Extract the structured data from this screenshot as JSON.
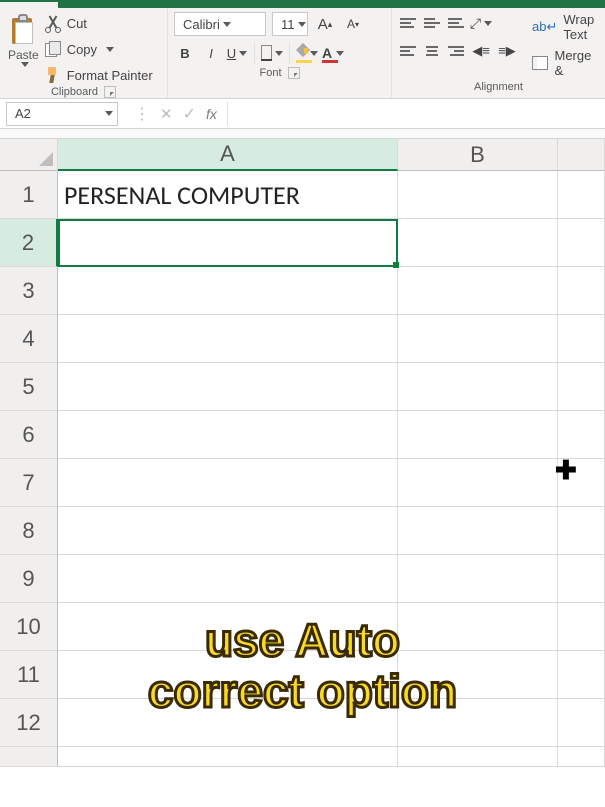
{
  "ribbon": {
    "clipboard": {
      "paste_label": "Paste",
      "cut_label": "Cut",
      "copy_label": "Copy",
      "format_painter_label": "Format Painter",
      "group_label": "Clipboard"
    },
    "font": {
      "name": "Calibri",
      "size": "11",
      "increase": "A",
      "decrease": "A",
      "bold": "B",
      "italic": "I",
      "underline": "U",
      "font_color_glyph": "A",
      "group_label": "Font"
    },
    "alignment": {
      "wrap_label": "Wrap Text",
      "merge_label": "Merge & ",
      "group_label": "Alignment"
    }
  },
  "formula_bar": {
    "name_box": "A2",
    "fx_label": "fx",
    "value": ""
  },
  "columns": [
    "A",
    "B"
  ],
  "rows": [
    "1",
    "2",
    "3",
    "4",
    "5",
    "6",
    "7",
    "8",
    "9",
    "10",
    "11",
    "12"
  ],
  "active_cell": "A2",
  "cells": {
    "A1": "PERSENAL COMPUTER"
  },
  "caption_line1": "use Auto",
  "caption_line2": "correct option"
}
